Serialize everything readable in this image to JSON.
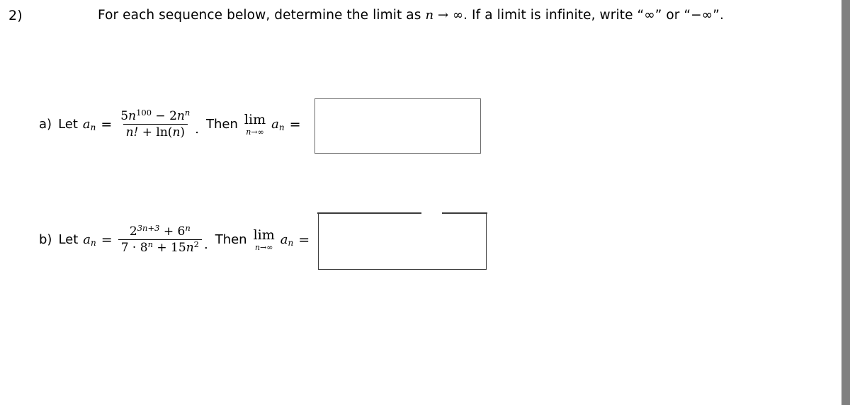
{
  "question": {
    "number": "2)",
    "prompt": {
      "part1": "For each sequence below, determine the limit as ",
      "variable": "n",
      "arrow": " → ",
      "infinity": "∞",
      "part2": ". If a limit is infinite, write “∞” or “−∞”."
    }
  },
  "parts": [
    {
      "label": "a)",
      "let_word": "Let",
      "sequence_name": "a",
      "sequence_sub": "n",
      "equals": "=",
      "expression": {
        "numerator": {
          "coef1": "5",
          "var1": "n",
          "exp1": "100",
          "operator": " − ",
          "coef2": "2",
          "var2": "n",
          "exp2": "n"
        },
        "denominator": {
          "term1": "n!",
          "operator": " + ",
          "term2_fn": "ln(",
          "term2_var": "n",
          "term2_close": ")"
        }
      },
      "period": ".",
      "then_word": "Then",
      "limit_op": "lim",
      "limit_sub_var": "n",
      "limit_sub_arrow": "→",
      "limit_sub_target": "∞",
      "limit_equals": "=",
      "answer_value": "",
      "answer_placeholder": ""
    },
    {
      "label": "b)",
      "let_word": "Let",
      "sequence_name": "a",
      "sequence_sub": "n",
      "equals": "=",
      "expression": {
        "numerator": {
          "base1": "2",
          "exp1": "3n+3",
          "operator": " + ",
          "base2": "6",
          "exp2": "n"
        },
        "denominator": {
          "coef1": "7",
          "dot": " · ",
          "base1": "8",
          "exp1": "n",
          "operator": " + ",
          "coef2": "15",
          "var2": "n",
          "exp2": "2"
        }
      },
      "period": ".",
      "then_word": "Then",
      "limit_op": "lim",
      "limit_sub_var": "n",
      "limit_sub_arrow": "→",
      "limit_sub_target": "∞",
      "limit_equals": "=",
      "answer_value": "",
      "answer_placeholder": ""
    }
  ],
  "colors": {
    "background": "#ffffff",
    "text": "#000000",
    "box_border_a": "#6e6e6e",
    "box_border_b": "#3b3b3b",
    "scrollbar": "#808080"
  }
}
